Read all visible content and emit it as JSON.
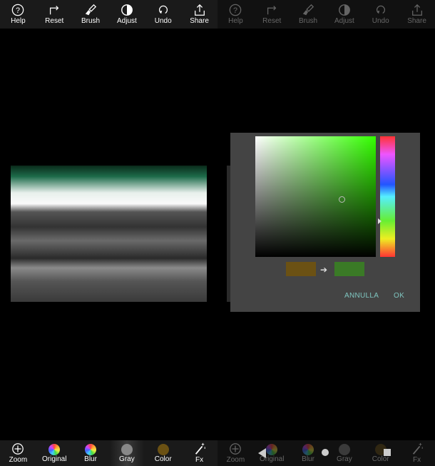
{
  "toolbar": {
    "items": [
      {
        "id": "help",
        "label": "Help"
      },
      {
        "id": "reset",
        "label": "Reset"
      },
      {
        "id": "brush",
        "label": "Brush"
      },
      {
        "id": "adjust",
        "label": "Adjust"
      },
      {
        "id": "undo",
        "label": "Undo"
      },
      {
        "id": "share",
        "label": "Share"
      }
    ]
  },
  "bottombar": {
    "items": [
      {
        "id": "zoom",
        "label": "Zoom"
      },
      {
        "id": "original",
        "label": "Original"
      },
      {
        "id": "blur",
        "label": "Blur"
      },
      {
        "id": "gray",
        "label": "Gray"
      },
      {
        "id": "color",
        "label": "Color"
      },
      {
        "id": "fx",
        "label": "Fx"
      }
    ],
    "selected": "gray"
  },
  "color_dialog": {
    "old_color": "#6b5113",
    "new_color": "#3a7a26",
    "hue_color": "#33ff00",
    "cancel_label": "ANNULLA",
    "ok_label": "OK"
  }
}
